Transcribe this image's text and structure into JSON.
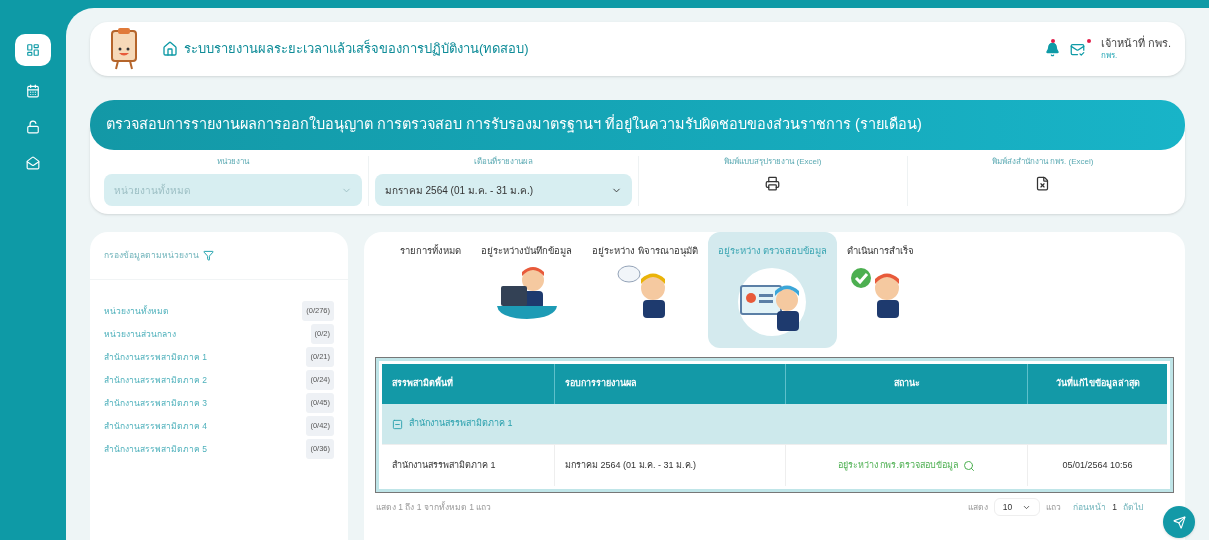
{
  "sidebar": {
    "items": [
      {
        "kind": "dashboard",
        "selected": true
      },
      {
        "kind": "calendar",
        "selected": false
      },
      {
        "kind": "unlock",
        "selected": false
      },
      {
        "kind": "mail",
        "selected": false
      }
    ]
  },
  "header": {
    "title": "ระบบรายงานผลระยะเวลาแล้วเสร็จของการปฏิบัติงาน(ทดสอบ)",
    "user_name": "เจ้าหน้าที่ กพร.",
    "user_role": "กพร.",
    "bell_unread": true,
    "mail_unread": true
  },
  "banner": {
    "title": "ตรวจสอบการรายงานผลการออกใบอนุญาต การตรวจสอบ การรับรองมาตรฐานฯ ที่อยู่ในความรับผิดชอบของส่วนราชการ (รายเดือน)"
  },
  "filters": [
    {
      "kind": "select",
      "label": "หน่วยงาน",
      "placeholder": "หน่วยงานทั้งหมด"
    },
    {
      "kind": "select",
      "label": "เดือนที่รายงานผล",
      "value": "มกราคม 2564 (01 ม.ค. - 31 ม.ค.)"
    },
    {
      "kind": "print",
      "label": "พิมพ์แบบสรุปรายงาน (Excel)"
    },
    {
      "kind": "excel",
      "label": "พิมพ์ส่งสำนักงาน กพร. (Excel)"
    }
  ],
  "unit_filter": {
    "title": "กรองข้อมูลตามหน่วยงาน",
    "items": [
      {
        "label": "หน่วยงานทั้งหมด",
        "count": "(0/276)"
      },
      {
        "label": "หน่วยงานส่วนกลาง",
        "count": "(0/2)"
      },
      {
        "label": "สำนักงานสรรพสามิตภาค 1",
        "count": "(0/21)"
      },
      {
        "label": "สำนักงานสรรพสามิตภาค 2",
        "count": "(0/24)"
      },
      {
        "label": "สำนักงานสรรพสามิตภาค 3",
        "count": "(0/45)"
      },
      {
        "label": "สำนักงานสรรพสามิตภาค 4",
        "count": "(0/42)"
      },
      {
        "label": "สำนักงานสรรพสามิตภาค 5",
        "count": "(0/36)"
      }
    ]
  },
  "tabs": [
    {
      "label": "รายการทั้งหมด",
      "selected": false,
      "kind": "none"
    },
    {
      "label": "อยู่ระหว่างบันทึกข้อมูล",
      "selected": false,
      "kind": "laptop"
    },
    {
      "label": "อยู่ระหว่าง พิจารณาอนุมัติ",
      "selected": false,
      "kind": "thinking"
    },
    {
      "label": "อยู่ระหว่าง ตรวจสอบข้อมูล",
      "selected": true,
      "kind": "presenting"
    },
    {
      "label": "ดำเนินการสำเร็จ",
      "selected": false,
      "kind": "success"
    }
  ],
  "table": {
    "columns": [
      "สรรพสามิตพื้นที่",
      "รอบการรายงานผล",
      "สถานะ",
      "วันที่แก้ไขข้อมูลล่าสุด"
    ],
    "group": "สำนักงานสรรพสามิตภาค 1",
    "rows": [
      {
        "area": "สำนักงานสรรพสามิตภาค 1",
        "period": "มกราคม 2564 (01 ม.ค. - 31 ม.ค.)",
        "status": "อยู่ระหว่าง กพร.ตรวจสอบข้อมูล",
        "updated": "05/01/2564 10:56"
      }
    ]
  },
  "footer": {
    "summary": "แสดง 1 ถึง 1 จากทั้งหมด 1 แถว",
    "show_label": "แสดง",
    "page_size": "10",
    "rows_label": "แถว",
    "prev": "ก่อนหน้า",
    "page": "1",
    "next": "ถัดไป"
  }
}
